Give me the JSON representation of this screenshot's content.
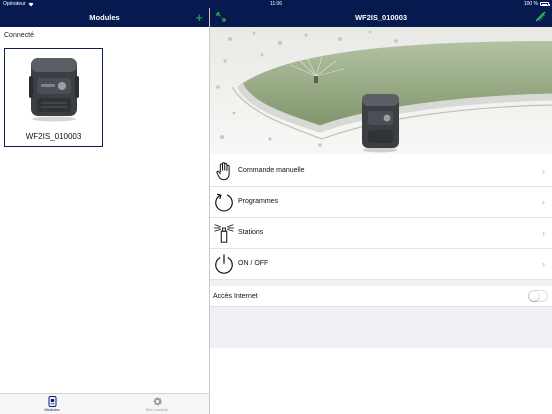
{
  "status_bar": {
    "carrier": "Opérateur",
    "time": "11:06",
    "battery": "100 %",
    "icons": [
      "wifi-icon",
      "battery-icon"
    ]
  },
  "left_nav": {
    "title": "Modules",
    "add_icon": "plus-icon"
  },
  "left_pane": {
    "section_label": "Connecté",
    "devices": [
      {
        "name": "WF2IS_010003",
        "icon": "controller-device-icon"
      }
    ]
  },
  "tab_bar": {
    "tabs": [
      {
        "label": "Modules",
        "icon": "modules-tab-icon",
        "active": true
      },
      {
        "label": "Mon compte",
        "icon": "gear-icon",
        "active": false
      }
    ]
  },
  "right_nav": {
    "title": "WF2IS_010003",
    "left_icon": "expand-arrows-icon",
    "right_icon": "signal-icon"
  },
  "menu": [
    {
      "label": "Commande manuelle",
      "icon": "hand-icon"
    },
    {
      "label": "Programmes",
      "icon": "refresh-cycle-icon"
    },
    {
      "label": "Stations",
      "icon": "sprinkler-station-icon"
    },
    {
      "label": "ON / OFF",
      "icon": "power-icon"
    }
  ],
  "internet": {
    "label": "Accès Internet",
    "enabled": false
  },
  "colors": {
    "nav_bg": "#061a4f",
    "accent_green": "#35c24a",
    "active_tab": "#0a1e7a",
    "group_bg": "#efeff4"
  }
}
